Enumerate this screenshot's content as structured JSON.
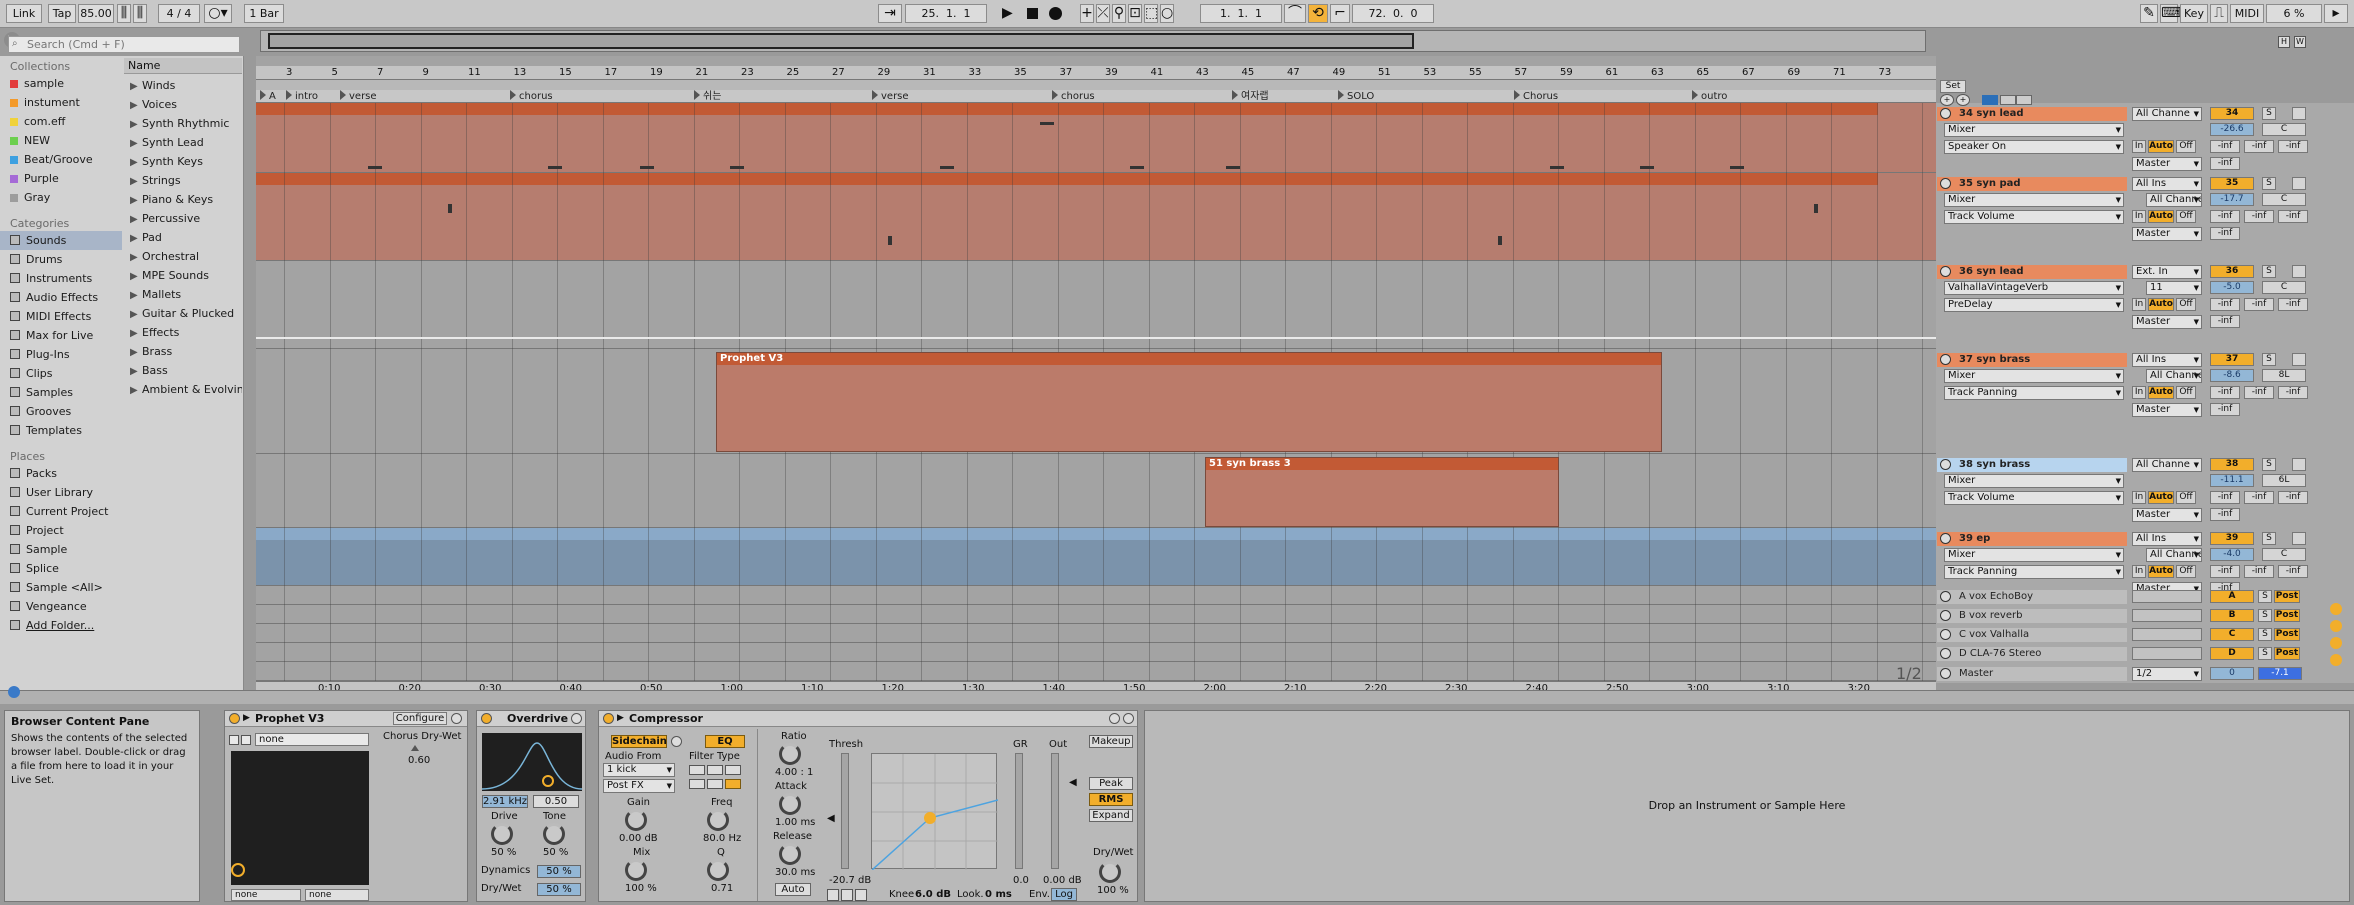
{
  "toolbar": {
    "link": "Link",
    "tap": "Tap",
    "tempo": "85.00",
    "sig_num": "4",
    "sig_den": "4",
    "quant": "1 Bar",
    "pos_bar": "25",
    "pos_beat": "1",
    "pos_sixteenth": "1",
    "loop_start_bar": "1",
    "loop_start_beat": "1",
    "loop_start_sixteenth": "1",
    "loop_len_bar": "72",
    "loop_len_beat": "0",
    "loop_len_sixteenth": "0",
    "key": "Key",
    "midi": "MIDI",
    "cpu": "6 %"
  },
  "browser": {
    "search_placeholder": "Search (Cmd + F)",
    "collections_title": "Collections",
    "collections": [
      {
        "label": "sample",
        "color": "#e23b3b"
      },
      {
        "label": "instument",
        "color": "#f39a2a"
      },
      {
        "label": "com.eff",
        "color": "#f0d23a"
      },
      {
        "label": "NEW",
        "color": "#6ccf4e"
      },
      {
        "label": "Beat/Groove",
        "color": "#3da0e0"
      },
      {
        "label": "Purple",
        "color": "#a56ad6"
      },
      {
        "label": "Gray",
        "color": "#9d9d9d"
      }
    ],
    "categories_title": "Categories",
    "categories": [
      "Sounds",
      "Drums",
      "Instruments",
      "Audio Effects",
      "MIDI Effects",
      "Max for Live",
      "Plug-Ins",
      "Clips",
      "Samples",
      "Grooves",
      "Templates"
    ],
    "places_title": "Places",
    "places": [
      "Packs",
      "User Library",
      "Current Project",
      "Project",
      "Sample",
      "Splice",
      "Sample <All>",
      "Vengeance",
      "Add Folder..."
    ],
    "name_header": "Name",
    "names": [
      "Winds",
      "Voices",
      "Synth Rhythmic",
      "Synth Lead",
      "Synth Keys",
      "Strings",
      "Piano & Keys",
      "Percussive",
      "Pad",
      "Orchestral",
      "MPE Sounds",
      "Mallets",
      "Guitar & Plucked",
      "Effects",
      "Brass",
      "Bass",
      "Ambient & Evolving"
    ]
  },
  "ruler": {
    "bars": [
      "3",
      "5",
      "7",
      "9",
      "11",
      "13",
      "15",
      "17",
      "19",
      "21",
      "23",
      "25",
      "27",
      "29",
      "31",
      "33",
      "35",
      "37",
      "39",
      "41",
      "43",
      "45",
      "47",
      "49",
      "51",
      "53",
      "55",
      "57",
      "59",
      "61",
      "63",
      "65",
      "67",
      "69",
      "71",
      "73"
    ]
  },
  "locators": [
    "A",
    "intro",
    "verse",
    "chorus",
    "쉬는",
    "verse",
    "chorus",
    "여자랩",
    "SOLO",
    "Chorus",
    "outro"
  ],
  "time_ruler": [
    "0:10",
    "0:20",
    "0:30",
    "0:40",
    "0:50",
    "1:00",
    "1:10",
    "1:20",
    "1:30",
    "1:40",
    "1:50",
    "2:00",
    "2:10",
    "2:20",
    "2:30",
    "2:40",
    "2:50",
    "3:00",
    "3:10",
    "3:20"
  ],
  "page_indicator": "1/2",
  "clips": {
    "prophet": "Prophet V3",
    "brass3": "51 syn brass 3"
  },
  "tracks": [
    {
      "name": "34 syn lead",
      "num": "34",
      "in": "All Channe",
      "d1": "Mixer",
      "d2": "Speaker On",
      "out": "Master",
      "vol": "-26.6",
      "pan": "C"
    },
    {
      "name": "35 syn pad",
      "num": "35",
      "in": "All Ins",
      "d1": "Mixer",
      "d2": "Track Volume",
      "out": "Master",
      "vol": "-17.7",
      "pan": "C",
      "in2": "All Channe"
    },
    {
      "name": "36 syn lead",
      "num": "36",
      "in": "Ext. In",
      "d1": "ValhallaVintageVerb",
      "d2": "PreDelay",
      "out": "Master",
      "vol": "-5.0",
      "pan": "C",
      "in2": "11"
    },
    {
      "name": "37 syn brass",
      "num": "37",
      "in": "All Ins",
      "d1": "Mixer",
      "d2": "Track Panning",
      "out": "Master",
      "vol": "-8.6",
      "pan": "8L",
      "in2": "All Channe"
    },
    {
      "name": "38 syn brass",
      "num": "38",
      "in": "All Channe",
      "d1": "Mixer",
      "d2": "Track Volume",
      "out": "Master",
      "vol": "-11.1",
      "pan": "6L"
    },
    {
      "name": "39 ep",
      "num": "39",
      "in": "All Ins",
      "d1": "Mixer",
      "d2": "Track Panning",
      "out": "Master",
      "vol": "-4.0",
      "pan": "C",
      "in2": "All Channe"
    }
  ],
  "mixer_labels": {
    "in": "In",
    "auto": "Auto",
    "off": "Off",
    "inf": "-inf",
    "s": "S",
    "post": "Post",
    "set": "Set"
  },
  "returns": [
    {
      "name": "A vox EchoBoy",
      "letter": "A"
    },
    {
      "name": "B vox reverb",
      "letter": "B"
    },
    {
      "name": "C vox Valhalla",
      "letter": "C"
    },
    {
      "name": "D CLA-76 Stereo",
      "letter": "D"
    }
  ],
  "master": {
    "name": "Master",
    "num": "0",
    "routing": "1/2",
    "vol": "-7.1"
  },
  "info": {
    "title": "Browser Content Pane",
    "text": "Shows the contents of the selected browser label. Double-click or drag a file from here to load it in your Live Set."
  },
  "devices": {
    "prophet": {
      "title": "Prophet V3",
      "configure": "Configure",
      "preset": "none",
      "param": "Chorus Dry-Wet",
      "param_val": "0.60",
      "sel1": "none",
      "sel2": "none"
    },
    "overdrive": {
      "title": "Overdrive",
      "freq": "2.91 kHz",
      "width": "0.50",
      "drive_l": "Drive",
      "drive_v": "50 %",
      "tone_l": "Tone",
      "tone_v": "50 %",
      "dyn_l": "Dynamics",
      "dyn_v": "50 %",
      "dw_l": "Dry/Wet",
      "dw_v": "50 %"
    },
    "compressor": {
      "title": "Compressor",
      "sidechain": "Sidechain",
      "eq": "EQ",
      "audio_from": "Audio From",
      "src": "1 kick",
      "tap": "Post FX",
      "gain_l": "Gain",
      "gain_v": "0.00 dB",
      "mix_l": "Mix",
      "mix_v": "100 %",
      "filter_type": "Filter Type",
      "freq_l": "Freq",
      "freq_v": "80.0 Hz",
      "q_l": "Q",
      "q_v": "0.71",
      "ratio_l": "Ratio",
      "ratio_v": "4.00 : 1",
      "attack_l": "Attack",
      "attack_v": "1.00 ms",
      "release_l": "Release",
      "release_v": "30.0 ms",
      "auto": "Auto",
      "thresh_l": "Thresh",
      "thresh_v": "-20.7 dB",
      "gr_l": "GR",
      "gr_v": "0.0",
      "out_l": "Out",
      "out_v": "0.00 dB",
      "makeup": "Makeup",
      "peak": "Peak",
      "rms": "RMS",
      "expand": "Expand",
      "knee_l": "Knee",
      "knee_v": "6.0 dB",
      "look_l": "Look.",
      "look_v": "0 ms",
      "env_l": "Env.",
      "env_v": "Log",
      "dw_l": "Dry/Wet",
      "dw_v": "100 %"
    },
    "drop": "Drop an Instrument or Sample Here"
  }
}
